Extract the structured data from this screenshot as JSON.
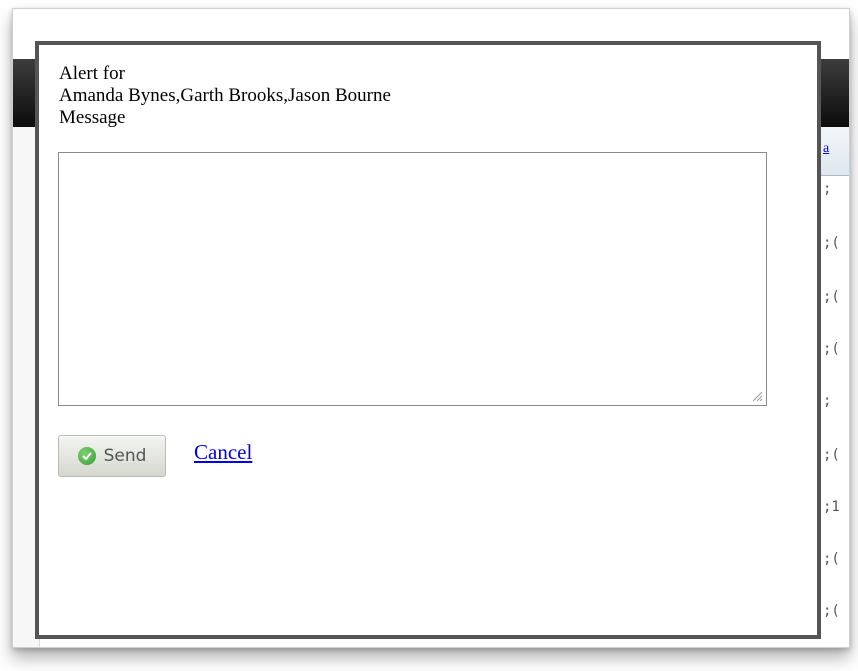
{
  "dialog": {
    "heading": "Alert for",
    "recipients": "Amanda Bynes,Garth Brooks,Jason Bourne",
    "message_label": "Message",
    "message_value": "",
    "send_label": "Send",
    "cancel_label": "Cancel"
  },
  "background": {
    "partial_link": "a",
    "partial_cells": [
      ";",
      ";(",
      ";(",
      ";(",
      ";",
      ";(",
      ";1",
      ";(",
      ";("
    ]
  },
  "colors": {
    "link": "#0000ee",
    "dialog_border": "#555555",
    "send_icon": "#3a9b35"
  },
  "icons": [
    "check-circle-icon",
    "resize-grip-icon"
  ]
}
